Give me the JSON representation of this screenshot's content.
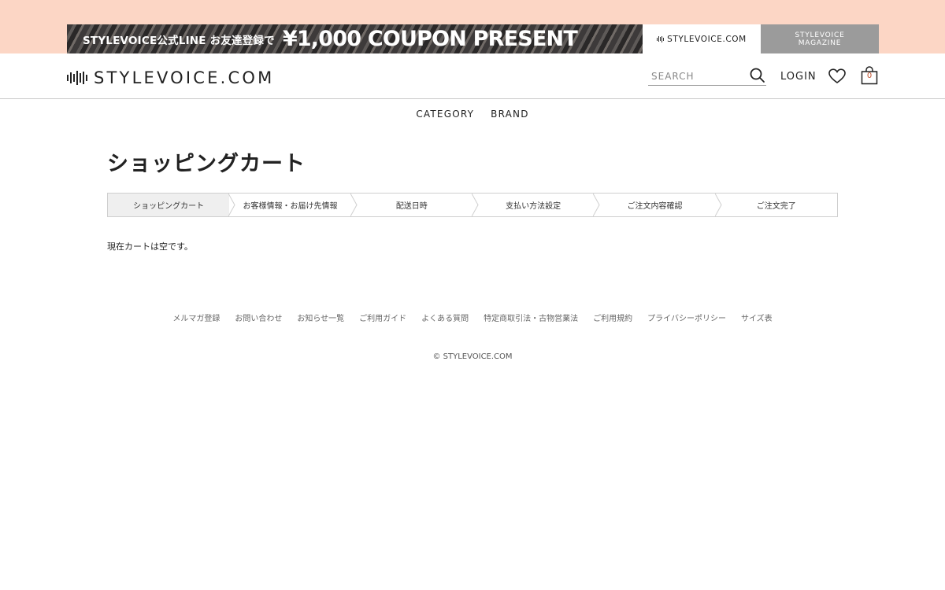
{
  "promo": {
    "small_text": "STYLEVOICE公式LINE お友達登録で",
    "big_text": "¥1,000 COUPON PRESENT"
  },
  "site_switch": {
    "stylevoice_label": "STYLEVOICE.COM",
    "magazine_line1": "STYLEVOICE",
    "magazine_line2": "MAGAZINE"
  },
  "header": {
    "logo_text": "STYLEVOICE.COM",
    "search_placeholder": "SEARCH",
    "login_label": "LOGIN",
    "cart_count": "0"
  },
  "nav": {
    "items": [
      "CATEGORY",
      "BRAND"
    ]
  },
  "page": {
    "title": "ショッピングカート",
    "steps": [
      "ショッピングカート",
      "お客様情報・お届け先情報",
      "配送日時",
      "支払い方法設定",
      "ご注文内容確認",
      "ご注文完了"
    ],
    "empty_message": "現在カートは空です。"
  },
  "footer": {
    "links": [
      "メルマガ登録",
      "お問い合わせ",
      "お知らせ一覧",
      "ご利用ガイド",
      "よくある質問",
      "特定商取引法・古物営業法",
      "ご利用規約",
      "プライバシーポリシー",
      "サイズ表"
    ],
    "copyright": "© STYLEVOICE.COM"
  },
  "colors": {
    "top_band": "#fcd6c5",
    "magazine_bg": "#9b9b9b",
    "active_step_bg": "#efefef",
    "cart_count": "#c0502c"
  }
}
